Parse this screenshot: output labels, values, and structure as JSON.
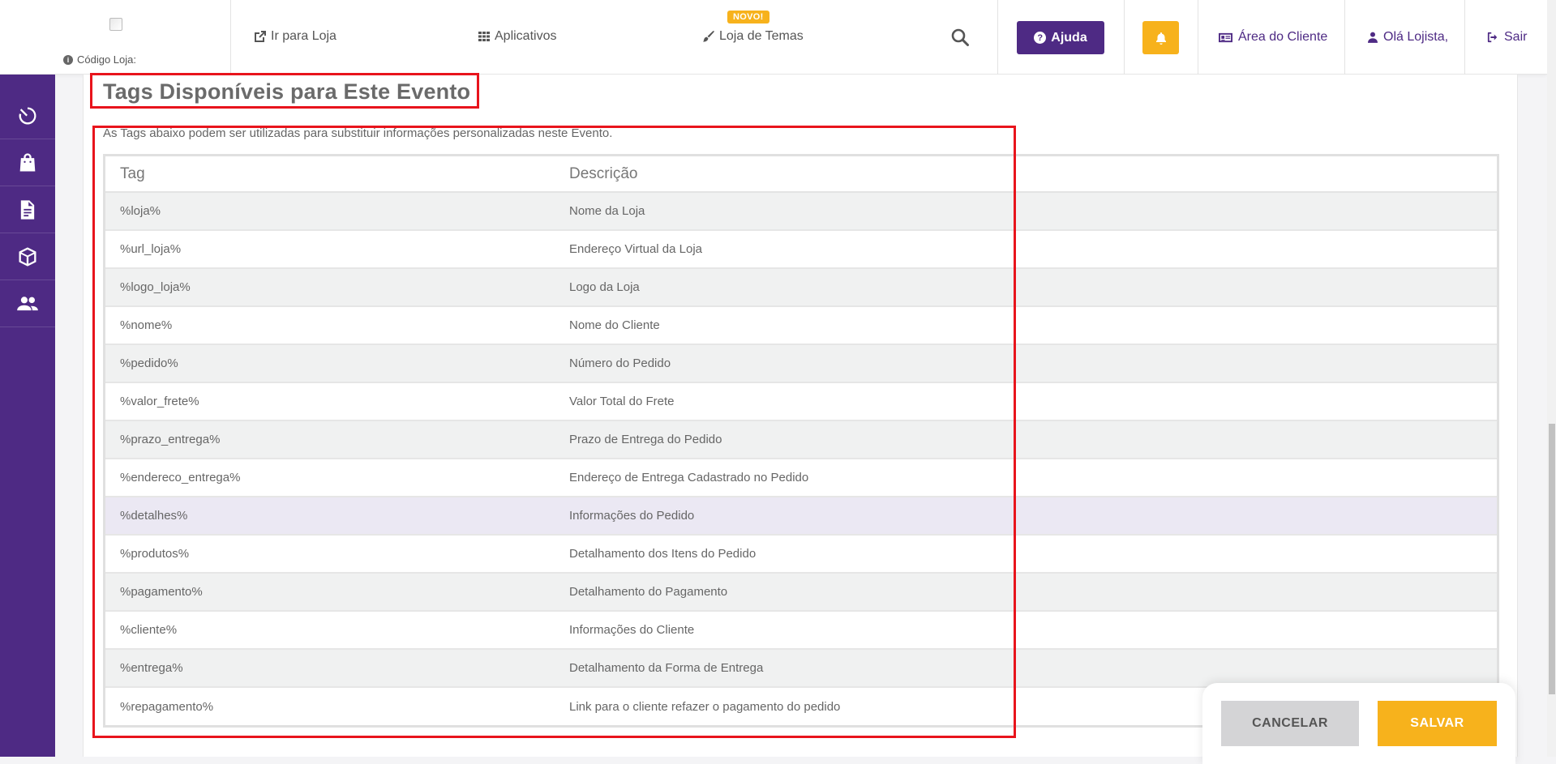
{
  "header": {
    "store_code_label": "Código Loja:",
    "go_to_store": "Ir para Loja",
    "apps": "Aplicativos",
    "themes_store": "Loja de Temas",
    "new_badge": "NOVO!",
    "help": "Ajuda",
    "client_area": "Área do Cliente",
    "greeting": "Olá Lojista,",
    "logout": "Sair"
  },
  "sidebar": {
    "items": [
      {
        "icon": "speed-icon"
      },
      {
        "icon": "shopping-bag-icon"
      },
      {
        "icon": "document-icon"
      },
      {
        "icon": "box-icon"
      },
      {
        "icon": "users-icon"
      }
    ]
  },
  "main": {
    "title": "Tags Disponíveis para Este Evento",
    "description": "As Tags abaixo podem ser utilizadas para substituir informações personalizadas neste Evento.",
    "table": {
      "columns": [
        "Tag",
        "Descrição"
      ],
      "rows": [
        {
          "tag": "%loja%",
          "desc": "Nome da Loja"
        },
        {
          "tag": "%url_loja%",
          "desc": "Endereço Virtual da Loja"
        },
        {
          "tag": "%logo_loja%",
          "desc": "Logo da Loja"
        },
        {
          "tag": "%nome%",
          "desc": "Nome do Cliente"
        },
        {
          "tag": "%pedido%",
          "desc": "Número do Pedido"
        },
        {
          "tag": "%valor_frete%",
          "desc": "Valor Total do Frete"
        },
        {
          "tag": "%prazo_entrega%",
          "desc": "Prazo de Entrega do Pedido"
        },
        {
          "tag": "%endereco_entrega%",
          "desc": "Endereço de Entrega Cadastrado no Pedido"
        },
        {
          "tag": "%detalhes%",
          "desc": "Informações do Pedido"
        },
        {
          "tag": "%produtos%",
          "desc": "Detalhamento dos Itens do Pedido"
        },
        {
          "tag": "%pagamento%",
          "desc": "Detalhamento do Pagamento"
        },
        {
          "tag": "%cliente%",
          "desc": "Informações do Cliente"
        },
        {
          "tag": "%entrega%",
          "desc": "Detalhamento da Forma de Entrega"
        },
        {
          "tag": "%repagamento%",
          "desc": "Link para o cliente refazer o pagamento do pedido"
        }
      ]
    }
  },
  "actions": {
    "cancel": "CANCELAR",
    "save": "SALVAR"
  },
  "colors": {
    "brand_purple": "#4e2a84",
    "accent_yellow": "#f7b21c",
    "annotation_red": "#e8141c",
    "highlight_row": "#ebe8f3"
  }
}
